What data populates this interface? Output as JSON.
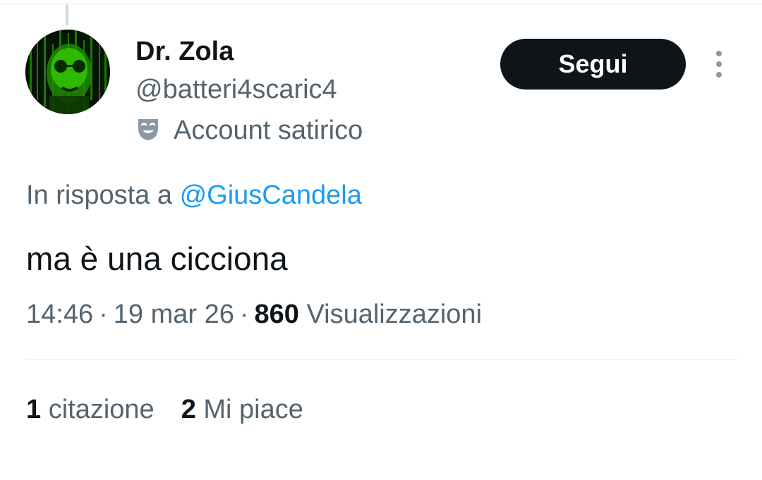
{
  "author": {
    "display_name": "Dr. Zola",
    "handle": "@batteri4scaric4",
    "label": "Account satirico",
    "label_icon": "theater-mask-icon",
    "avatar_icon": "green-matrix-face-avatar"
  },
  "actions": {
    "follow_label": "Segui",
    "more_icon": "more-vertical-icon"
  },
  "reply": {
    "prefix": "In risposta a ",
    "mention": "@GiusCandela"
  },
  "tweet": {
    "text": "ma è una cicciona"
  },
  "meta": {
    "time": "14:46",
    "separator": "·",
    "date": "19 mar 26",
    "views_count": "860",
    "views_label": "Visualizzazioni"
  },
  "stats": {
    "quotes_count": "1",
    "quotes_label": "citazione",
    "likes_count": "2",
    "likes_label": "Mi piace"
  },
  "colors": {
    "text_primary": "#0f1419",
    "text_secondary": "#536471",
    "accent_link": "#1d9bf0",
    "button_bg": "#0f1419",
    "avatar_green": "#2bd100"
  }
}
